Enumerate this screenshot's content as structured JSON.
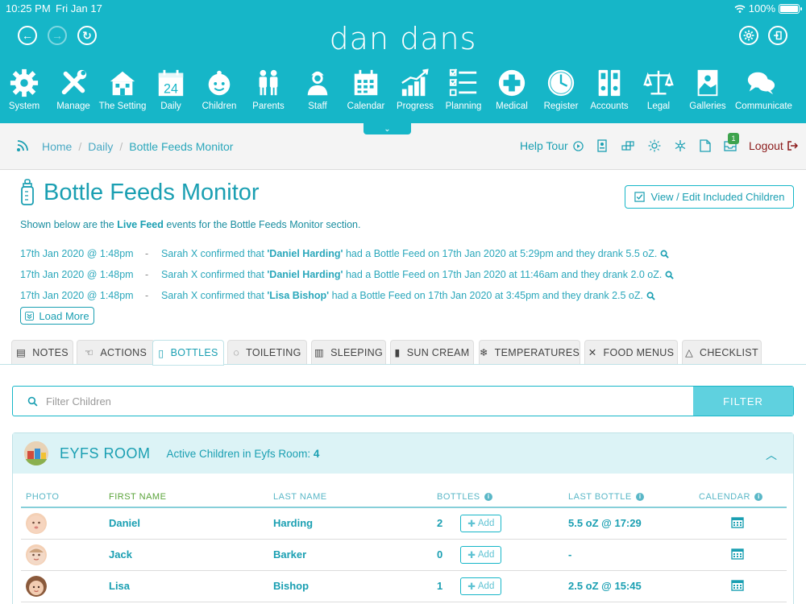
{
  "status": {
    "time": "10:25 PM",
    "date": "Fri Jan 17",
    "battery": "100%"
  },
  "brand": "dan dans",
  "nav": {
    "items": [
      {
        "label": "System",
        "icon": "gear-icon"
      },
      {
        "label": "Manage",
        "icon": "tools-icon"
      },
      {
        "label": "The Setting",
        "icon": "building-icon"
      },
      {
        "label": "Daily",
        "icon": "calendar-day-icon",
        "day": "24"
      },
      {
        "label": "Children",
        "icon": "child-face-icon"
      },
      {
        "label": "Parents",
        "icon": "parents-icon"
      },
      {
        "label": "Staff",
        "icon": "staff-icon"
      },
      {
        "label": "Calendar",
        "icon": "calendar-icon"
      },
      {
        "label": "Progress",
        "icon": "progress-chart-icon"
      },
      {
        "label": "Planning",
        "icon": "checklist-icon"
      },
      {
        "label": "Medical",
        "icon": "medical-cross-icon"
      },
      {
        "label": "Register",
        "icon": "clock-icon"
      },
      {
        "label": "Accounts",
        "icon": "binders-icon"
      },
      {
        "label": "Legal",
        "icon": "scales-icon"
      },
      {
        "label": "Galleries",
        "icon": "gallery-icon"
      },
      {
        "label": "Communicate",
        "icon": "chat-icon"
      }
    ]
  },
  "breadcrumb": {
    "home": "Home",
    "daily": "Daily",
    "current": "Bottle Feeds Monitor"
  },
  "toolbar": {
    "help_tour": "Help Tour",
    "notification_count": "1",
    "logout": "Logout"
  },
  "page": {
    "title": "Bottle Feeds Monitor",
    "view_edit_label": "View / Edit Included Children",
    "intro_prefix": "Shown below are the ",
    "intro_bold": "Live Feed",
    "intro_suffix": " events for the Bottle Feeds Monitor section.",
    "load_more": "Load More"
  },
  "events": [
    {
      "ts": "17th Jan 2020 @ 1:48pm",
      "pre": "Sarah X confirmed that ",
      "name": "'Daniel Harding'",
      "post": " had a Bottle Feed on 17th Jan 2020 at 5:29pm and they drank 5.5 oZ."
    },
    {
      "ts": "17th Jan 2020 @ 1:48pm",
      "pre": "Sarah X confirmed that ",
      "name": "'Daniel Harding'",
      "post": " had a Bottle Feed on 17th Jan 2020 at 11:46am and they drank 2.0 oZ."
    },
    {
      "ts": "17th Jan 2020 @ 1:48pm",
      "pre": "Sarah X confirmed that ",
      "name": "'Lisa Bishop'",
      "post": " had a Bottle Feed on 17th Jan 2020 at 3:45pm and they drank 2.5 oZ."
    }
  ],
  "tabs": [
    "NOTES",
    "ACTIONS",
    "BOTTLES",
    "TOILETING",
    "SLEEPING",
    "SUN CREAM",
    "TEMPERATURES",
    "FOOD MENUS",
    "CHECKLIST"
  ],
  "active_tab": "BOTTLES",
  "filter": {
    "placeholder": "Filter Children",
    "button": "FILTER"
  },
  "room": {
    "name": "EYFS ROOM",
    "active_label": "Active Children in Eyfs Room: ",
    "active_count": "4",
    "columns": {
      "photo": "PHOTO",
      "first_name": "FIRST NAME",
      "last_name": "LAST NAME",
      "bottles": "BOTTLES",
      "last_bottle": "LAST BOTTLE",
      "calendar": "CALENDAR"
    },
    "add_label": "Add",
    "rows": [
      {
        "first": "Daniel",
        "last": "Harding",
        "bottles": "2",
        "last_bottle": "5.5 oZ @ 17:29"
      },
      {
        "first": "Jack",
        "last": "Barker",
        "bottles": "0",
        "last_bottle": "-"
      },
      {
        "first": "Lisa",
        "last": "Bishop",
        "bottles": "1",
        "last_bottle": "2.5 oZ @ 15:45"
      }
    ]
  },
  "colors": {
    "brand": "#16b6c8",
    "link": "#1a9fb2",
    "logout": "#8b1a1a",
    "filter_button": "#5fd1df"
  }
}
